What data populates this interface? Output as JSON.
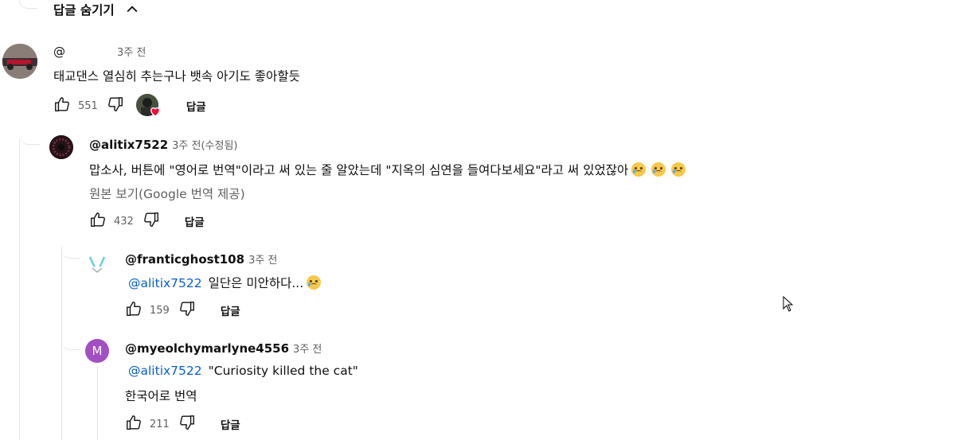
{
  "hide_replies": {
    "label": "답글 숨기기"
  },
  "comments": [
    {
      "author": "@",
      "time": "3주 전",
      "text": "태교댄스 열심히 추는구나 뱃속 아기도 좋아할듯",
      "likes": "551",
      "reply_label": "답글",
      "creator_heart": true
    },
    {
      "author": "@alitix7522",
      "time": "3주 전(수정됨)",
      "text": "맙소사, 버튼에 \"영어로 번역\"이라고 써 있는 줄 알았는데 \"지옥의 심연을 들여다보세요\"라고 써 있었잖아",
      "translate_note": "원본 보기(Google 번역 제공)",
      "likes": "432",
      "reply_label": "답글"
    },
    {
      "author": "@franticghost108",
      "time": "3주 전",
      "mention": "@alitix7522",
      "text": "일단은 미안하다...",
      "likes": "159",
      "reply_label": "답글"
    },
    {
      "author": "@myeolchymarlyne4556",
      "avatar_letter": "M",
      "time": "3주 전",
      "mention": "@alitix7522",
      "text": "\"Curiosity killed the cat\"",
      "translate_note": "한국어로 번역",
      "likes": "211",
      "reply_label": "답글"
    }
  ],
  "colors": {
    "link": "#065fd4",
    "muted": "#606060",
    "avatar_m": "#a24ec5",
    "heart": "#ff0033"
  },
  "icons": [
    "chevron-up-icon",
    "thumbs-up-icon",
    "thumbs-down-icon",
    "heart-icon",
    "emoji-crying-icon",
    "mouse-cursor-icon"
  ]
}
